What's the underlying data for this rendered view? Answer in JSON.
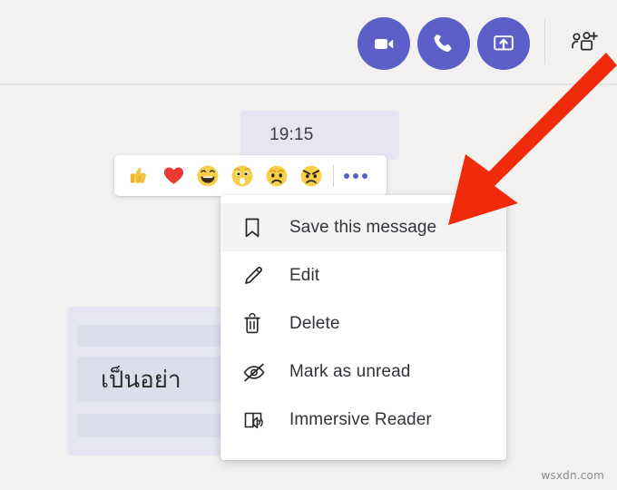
{
  "app": {
    "name": "Microsoft Teams chat",
    "background_color": "#f2f1f0",
    "accent_color": "#5b5fc7"
  },
  "header": {
    "buttons": [
      {
        "name": "video-call",
        "label": "Video call",
        "icon": "video-camera-icon"
      },
      {
        "name": "audio-call",
        "label": "Audio call",
        "icon": "phone-icon"
      },
      {
        "name": "share-screen",
        "label": "Share screen",
        "icon": "share-screen-icon"
      }
    ],
    "add_people": {
      "label": "Add people",
      "icon": "add-people-icon"
    }
  },
  "conversation": {
    "timestamp": "19:15",
    "message_text": "เป็นอย่า"
  },
  "reaction_bar": {
    "reactions": [
      {
        "name": "like",
        "label": "Like",
        "icon": "thumbs-up-icon"
      },
      {
        "name": "heart",
        "label": "Heart",
        "icon": "heart-icon"
      },
      {
        "name": "laugh",
        "label": "Laugh",
        "icon": "laugh-icon"
      },
      {
        "name": "surprised",
        "label": "Surprised",
        "icon": "surprised-icon"
      },
      {
        "name": "sad",
        "label": "Sad",
        "icon": "sad-icon"
      },
      {
        "name": "angry",
        "label": "Angry",
        "icon": "angry-icon"
      }
    ],
    "more_label": "More options"
  },
  "context_menu": {
    "items": [
      {
        "label": "Save this message",
        "icon": "bookmark-icon",
        "highlighted": true
      },
      {
        "label": "Edit",
        "icon": "pencil-icon",
        "highlighted": false
      },
      {
        "label": "Delete",
        "icon": "trash-icon",
        "highlighted": false
      },
      {
        "label": "Mark as unread",
        "icon": "eye-slash-icon",
        "highlighted": false
      },
      {
        "label": "Immersive Reader",
        "icon": "immersive-reader-icon",
        "highlighted": false
      }
    ]
  },
  "annotation": {
    "arrow_color": "#f02b0c",
    "points_to": "Save this message"
  },
  "watermark": {
    "text": "wsxdn.com"
  }
}
